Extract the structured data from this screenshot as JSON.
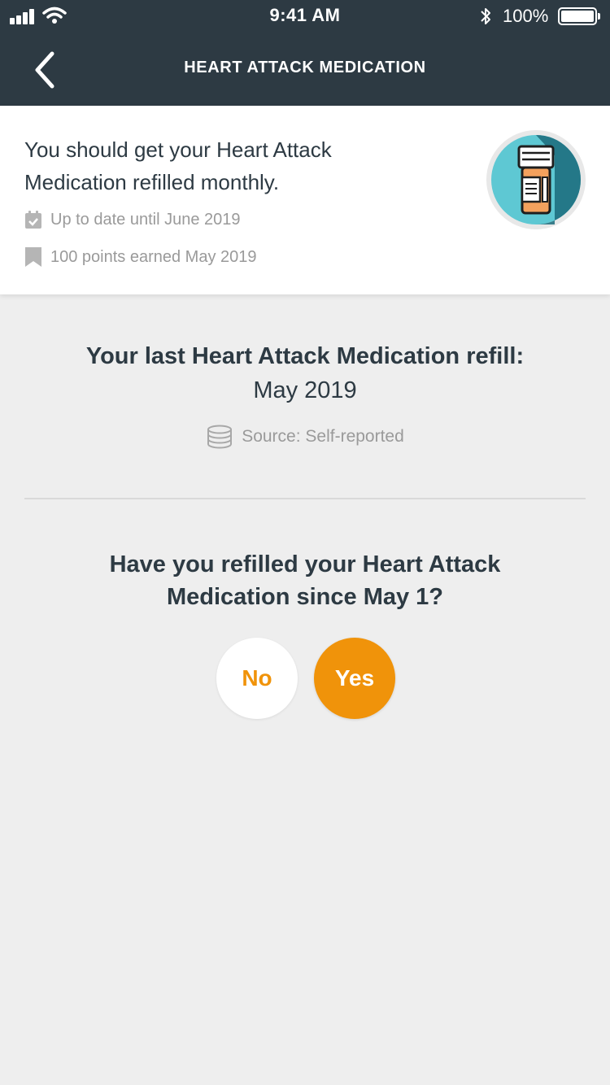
{
  "status_bar": {
    "time": "9:41 AM",
    "battery_percent": "100%",
    "icons": [
      "signal-icon",
      "wifi-icon",
      "bluetooth-icon",
      "battery-icon"
    ]
  },
  "nav": {
    "title": "HEART ATTACK MEDICATION",
    "back_icon": "chevron-left-icon"
  },
  "summary": {
    "text": "You should get your Heart Attack Medication refilled monthly.",
    "status_icon": "calendar-check-icon",
    "status_text": "Up to date until June 2019",
    "points_icon": "bookmark-icon",
    "points_text": "100 points earned May 2019",
    "badge_icon": "pill-bottle-icon"
  },
  "last_refill": {
    "title": "Your last Heart Attack Medication refill:",
    "date": "May 2019",
    "source_icon": "database-icon",
    "source_text": "Source: Self-reported"
  },
  "question": {
    "text": "Have you refilled your Heart Attack Medication since May 1?",
    "no_label": "No",
    "yes_label": "Yes"
  },
  "colors": {
    "header_bg": "#2d3a43",
    "accent": "#f0930a",
    "background": "#eeeeee",
    "badge_teal": "#5ec8d3",
    "badge_dark_teal": "#1a6a7a",
    "bottle_orange": "#f4a15d"
  }
}
